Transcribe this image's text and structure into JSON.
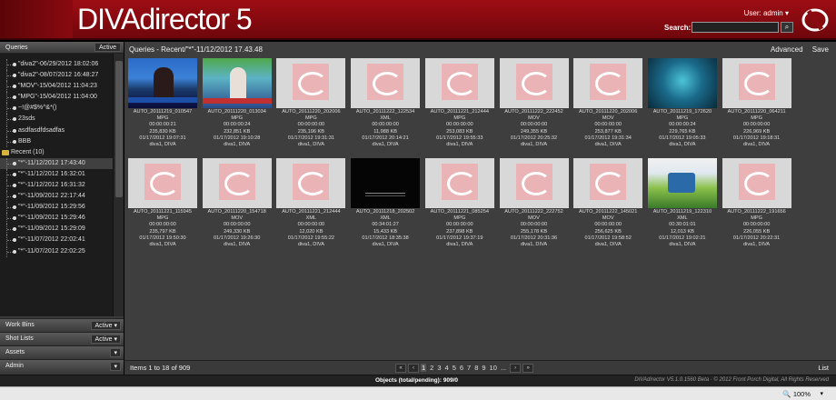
{
  "header": {
    "logo": "DIVAdirector 5",
    "user": "User: admin ▾",
    "search_label": "Search:",
    "search_value": "",
    "search_button": "⌕"
  },
  "sidebar": {
    "queries_label": "Queries",
    "queries_mode": "Active",
    "tree": [
      {
        "label": "\"diva2\"-06/29/2012 18:02:06"
      },
      {
        "label": "\"diva2\"-08/07/2012 16:48:27"
      },
      {
        "label": "\"MOV\"-15/04/2012 11:04:23"
      },
      {
        "label": "\"MPG\"-15/04/2012 11:04:00"
      },
      {
        "label": "~!@#$%^&*()"
      },
      {
        "label": "23sds"
      },
      {
        "label": "asdfasdfdsadfas"
      },
      {
        "label": "BBB"
      }
    ],
    "recent_folder": "Recent (10)",
    "recent": [
      {
        "label": "\"*\"-11/12/2012 17:43:40",
        "selected": true
      },
      {
        "label": "\"*\"-11/12/2012 16:32:01"
      },
      {
        "label": "\"*\"-11/12/2012 16:31:32"
      },
      {
        "label": "\"*\"-11/09/2012 22:17:44"
      },
      {
        "label": "\"*\"-11/09/2012 15:29:56"
      },
      {
        "label": "\"*\"-11/09/2012 15:29:46"
      },
      {
        "label": "\"*\"-11/09/2012 15:29:09"
      },
      {
        "label": "\"*\"-11/07/2012 22:02:41"
      },
      {
        "label": "\"*\"-11/07/2012 22:02:25"
      }
    ],
    "panels": [
      {
        "label": "Work Bins",
        "mode": "Active ▾"
      },
      {
        "label": "Shot Lists",
        "mode": "Active ▾"
      },
      {
        "label": "Assets",
        "mode": "▾"
      },
      {
        "label": "Admin",
        "mode": "▾"
      }
    ]
  },
  "main": {
    "breadcrumb": "Queries  -  Recent/\"*\"-11/12/2012 17.43.48",
    "advanced": "Advanced",
    "save": "Save",
    "tiles": [
      {
        "name": "AUTO_20111219_010547",
        "fmt": "MPG",
        "dur": "00:00:00:21",
        "size": "235,830 KB",
        "date": "01/17/2012 19:07:31",
        "loc": "diva1, DIVA",
        "thumb": "news"
      },
      {
        "name": "AUTO_20111220_013034",
        "fmt": "MPG",
        "dur": "00:00:00:24",
        "size": "232,851 KB",
        "date": "01/17/2012 19:10:28",
        "loc": "diva1, DIVA",
        "thumb": "anchor"
      },
      {
        "name": "AUTO_20111220_202006",
        "fmt": "MPG",
        "dur": "00:00:00:00",
        "size": "235,196 KB",
        "date": "01/17/2012 19:31:31",
        "loc": "diva1, DIVA",
        "thumb": "ph"
      },
      {
        "name": "AUTO_20111222_122534",
        "fmt": "XML",
        "dur": "00:00:00:00",
        "size": "11,988 KB",
        "date": "01/17/2012 20:14:21",
        "loc": "diva1, DIVA",
        "thumb": "ph"
      },
      {
        "name": "AUTO_20111221_212444",
        "fmt": "MPG",
        "dur": "00:00:00:00",
        "size": "253,083 KB",
        "date": "01/17/2012 19:55:33",
        "loc": "diva1, DIVA",
        "thumb": "ph"
      },
      {
        "name": "AUTO_20111222_222452",
        "fmt": "MOV",
        "dur": "00:00:00:00",
        "size": "249,355 KB",
        "date": "01/17/2012 20:25:32",
        "loc": "diva1, DIVA",
        "thumb": "ph"
      },
      {
        "name": "AUTO_20111220_202006",
        "fmt": "MOV",
        "dur": "00:00:00:00",
        "size": "253,877 KB",
        "date": "01/17/2012 19:31:34",
        "loc": "diva1, DIVA",
        "thumb": "ph"
      },
      {
        "name": "AUTO_20111219_172620",
        "fmt": "MPG",
        "dur": "00:00:00:24",
        "size": "229,765 KB",
        "date": "01/17/2012 19:05:33",
        "loc": "diva1, DIVA",
        "thumb": "blue"
      },
      {
        "name": "AUTO_20111220_064211",
        "fmt": "MPG",
        "dur": "00:00:00:00",
        "size": "226,969 KB",
        "date": "01/17/2012 19:18:31",
        "loc": "diva1, DIVA",
        "thumb": "ph"
      },
      {
        "name": "AUTO_20111221_115945",
        "fmt": "MPG",
        "dur": "00:00:00:00",
        "size": "235,797 KB",
        "date": "01/17/2012 19:50:30",
        "loc": "diva1, DIVA",
        "thumb": "ph"
      },
      {
        "name": "AUTO_20111220_154718",
        "fmt": "MOV",
        "dur": "00:00:00:00",
        "size": "249,330 KB",
        "date": "01/17/2012 19:26:30",
        "loc": "diva1, DIVA",
        "thumb": "ph"
      },
      {
        "name": "AUTO_20111221_212444",
        "fmt": "XML",
        "dur": "00:00:00:00",
        "size": "12,020 KB",
        "date": "01/17/2012 19:55:22",
        "loc": "diva1, DIVA",
        "thumb": "ph"
      },
      {
        "name": "AUTO_20111218_202502",
        "fmt": "XML",
        "dur": "00:34:01:27",
        "size": "15,433 KB",
        "date": "01/17/2012 18:35:38",
        "loc": "diva1, DIVA",
        "thumb": "dark"
      },
      {
        "name": "AUTO_20111221_085254",
        "fmt": "MPG",
        "dur": "00:00:00:00",
        "size": "237,898 KB",
        "date": "01/17/2012 19:37:19",
        "loc": "diva1, DIVA",
        "thumb": "ph"
      },
      {
        "name": "AUTO_20111222_222752",
        "fmt": "MOV",
        "dur": "00:00:00:00",
        "size": "255,178 KB",
        "date": "01/17/2012 20:31:36",
        "loc": "diva1, DIVA",
        "thumb": "ph"
      },
      {
        "name": "AUTO_20111222_145021",
        "fmt": "MOV",
        "dur": "00:00:00:00",
        "size": "256,625 KB",
        "date": "01/17/2012 19:58:52",
        "loc": "diva1, DIVA",
        "thumb": "ph"
      },
      {
        "name": "AUTO_20111219_122310",
        "fmt": "XML",
        "dur": "00:30:01:01",
        "size": "12,013 KB",
        "date": "01/17/2012 19:02:21",
        "loc": "diva1, DIVA",
        "thumb": "bike"
      },
      {
        "name": "AUTO_20111222_191656",
        "fmt": "MPG",
        "dur": "00:00:00:00",
        "size": "226,055 KB",
        "date": "01/17/2012 20:22:31",
        "loc": "diva1, DIVA",
        "thumb": "ph"
      }
    ]
  },
  "footer": {
    "items": "Items 1 to 18 of 909",
    "pages": [
      "1",
      "2",
      "3",
      "4",
      "5",
      "6",
      "7",
      "8",
      "9",
      "10",
      "..."
    ],
    "list": "List"
  },
  "status": {
    "objects": "Objects (total/pending): 909/0",
    "version": "DIVAdirector V5.1.0.1560 Beta  ·  © 2012 Front Porch Digital, All Rights Reserved",
    "zoom": "100%"
  }
}
